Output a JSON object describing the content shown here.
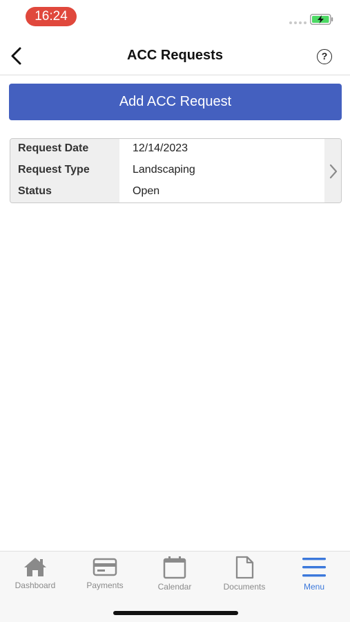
{
  "status_bar": {
    "time": "16:24"
  },
  "nav": {
    "title": "ACC Requests",
    "help_symbol": "?"
  },
  "add_button": {
    "label": "Add ACC Request"
  },
  "request": {
    "rows": [
      {
        "label": "Request Date",
        "value": "12/14/2023"
      },
      {
        "label": "Request Type",
        "value": "Landscaping"
      },
      {
        "label": "Status",
        "value": "Open"
      }
    ]
  },
  "tabs": [
    {
      "label": "Dashboard",
      "icon": "home-icon"
    },
    {
      "label": "Payments",
      "icon": "credit-card-icon"
    },
    {
      "label": "Calendar",
      "icon": "calendar-icon"
    },
    {
      "label": "Documents",
      "icon": "document-icon"
    },
    {
      "label": "Menu",
      "icon": "hamburger-menu-icon",
      "active": true
    }
  ],
  "colors": {
    "accent": "#4460bf",
    "active_tab": "#3b78db",
    "time_pill": "#e0483c",
    "battery_fill": "#4cd964"
  }
}
